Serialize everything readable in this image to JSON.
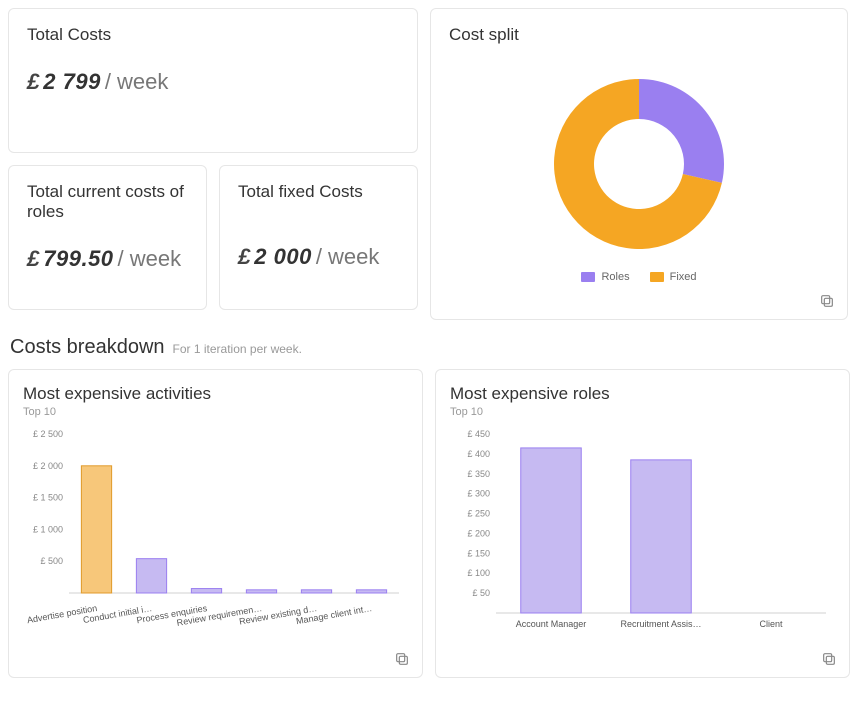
{
  "total_costs": {
    "title": "Total Costs",
    "currency": "£",
    "amount": "2 799",
    "suffix": "/ week"
  },
  "roles_costs": {
    "title": "Total current costs of roles",
    "currency": "£",
    "amount": "799.50",
    "suffix": "/ week"
  },
  "fixed_costs": {
    "title": "Total fixed Costs",
    "currency": "£",
    "amount": "2 000",
    "suffix": "/ week"
  },
  "cost_split": {
    "title": "Cost split",
    "legend": {
      "roles": "Roles",
      "fixed": "Fixed"
    },
    "colors": {
      "roles": "#9a7ff0",
      "fixed": "#f5a623"
    }
  },
  "breakdown": {
    "heading": "Costs breakdown",
    "sub": "For 1 iteration per week."
  },
  "activities_chart": {
    "title": "Most expensive activities",
    "sub": "Top 10"
  },
  "roles_chart": {
    "title": "Most expensive roles",
    "sub": "Top 10"
  },
  "chart_data": [
    {
      "id": "cost_split",
      "type": "pie",
      "title": "Cost split",
      "series": [
        {
          "name": "Roles",
          "value": 799.5,
          "color": "#9a7ff0"
        },
        {
          "name": "Fixed",
          "value": 2000,
          "color": "#f5a623"
        }
      ]
    },
    {
      "id": "activities",
      "type": "bar",
      "title": "Most expensive activities",
      "ylabel": "£",
      "ylim": [
        0,
        2500
      ],
      "yticks": [
        500,
        1000,
        1500,
        2000,
        2500
      ],
      "categories": [
        "Advertise position",
        "Conduct initial i…",
        "Process enquiries",
        "Review requiremen…",
        "Review existing d…",
        "Manage client int…"
      ],
      "values": [
        2000,
        540,
        70,
        50,
        50,
        50
      ],
      "bar_colors": [
        "#f7c77a",
        "#c6baf2",
        "#c6baf2",
        "#c6baf2",
        "#c6baf2",
        "#c6baf2"
      ],
      "bar_strokes": [
        "#e09a2b",
        "#9a7ff0",
        "#9a7ff0",
        "#9a7ff0",
        "#9a7ff0",
        "#9a7ff0"
      ]
    },
    {
      "id": "roles",
      "type": "bar",
      "title": "Most expensive roles",
      "ylabel": "£",
      "ylim": [
        0,
        450
      ],
      "yticks": [
        50,
        100,
        150,
        200,
        250,
        300,
        350,
        400,
        450
      ],
      "categories": [
        "Account Manager",
        "Recruitment Assis…",
        "Client"
      ],
      "values": [
        415,
        385,
        0
      ],
      "bar_colors": [
        "#c6baf2",
        "#c6baf2",
        "#c6baf2"
      ],
      "bar_strokes": [
        "#9a7ff0",
        "#9a7ff0",
        "#9a7ff0"
      ]
    }
  ]
}
